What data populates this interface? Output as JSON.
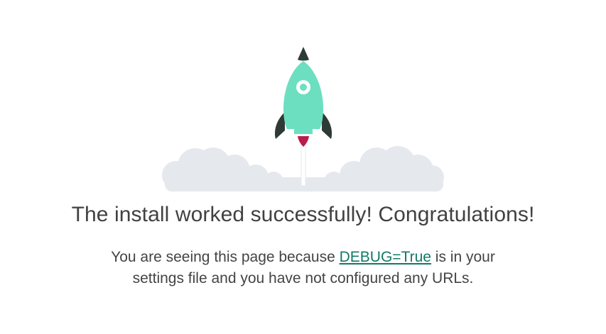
{
  "headline": "The install worked successfully! Congratulations!",
  "message": {
    "before_link": "You are seeing this page because ",
    "link_label": "DEBUG=True",
    "after_link": " is in your",
    "line2": "settings file and you have not configured any URLs."
  },
  "colors": {
    "rocket_body": "#6ddfc1",
    "rocket_dark": "#2f3a36",
    "flame": "#b81d4c",
    "cloud": "#e5e8ed",
    "link": "#117a65"
  },
  "illustration": {
    "icon": "rocket-launch-icon"
  }
}
